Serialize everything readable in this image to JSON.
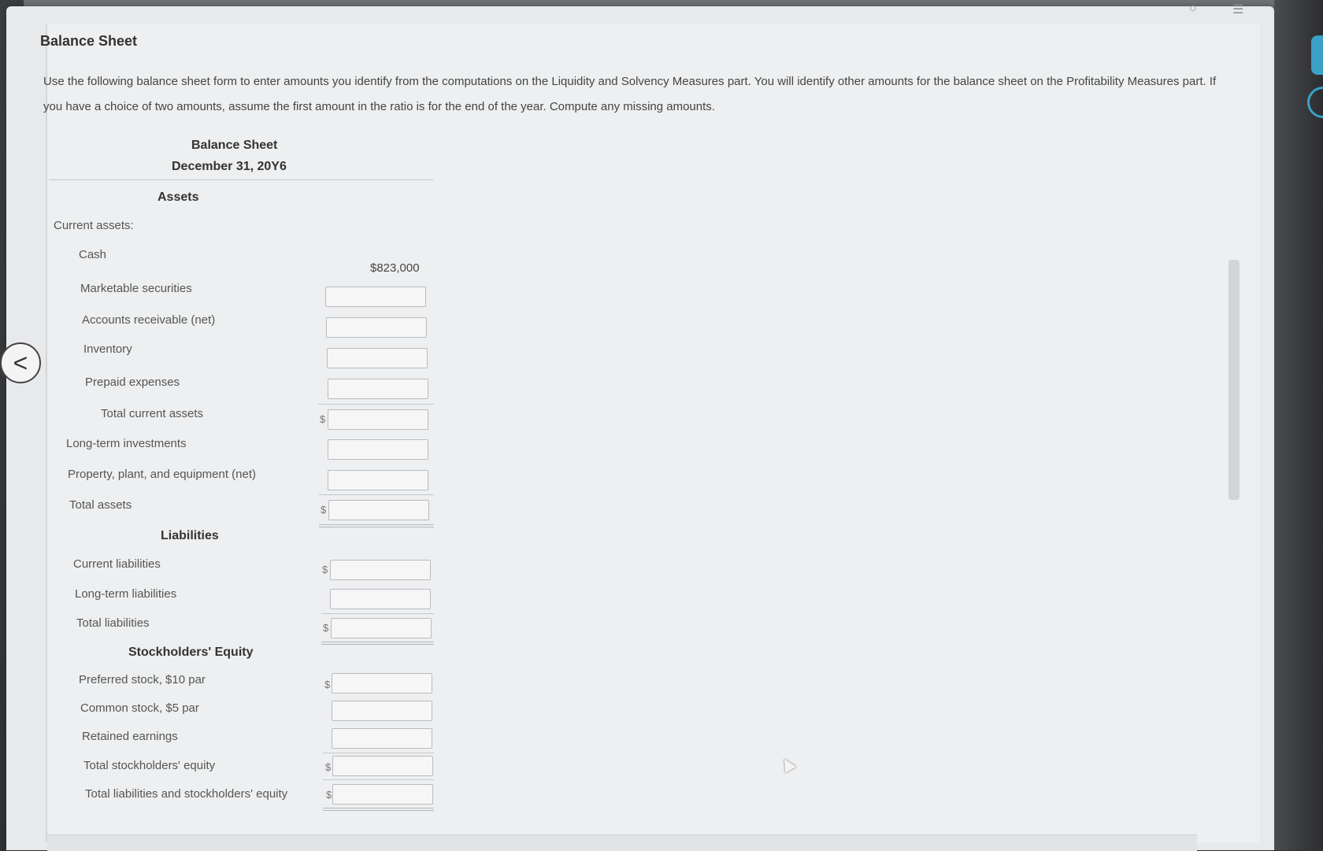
{
  "page": {
    "title": "Balance Sheet",
    "instructions": "Use the following balance sheet form to enter amounts you identify from the computations on the Liquidity and Solvency Measures part. You will identify other amounts for the balance sheet on the Profitability Measures part. If you have a choice of two amounts, assume the first amount in the ratio is for the end of the year. Compute any missing amounts."
  },
  "form": {
    "title": "Balance Sheet",
    "date": "December 31, 20Y6",
    "assets_header": "Assets",
    "current_assets_label": "Current assets:",
    "cash_label": "Cash",
    "cash_value": "$823,000",
    "marketable_securities_label": "Marketable securities",
    "accounts_receivable_label": "Accounts receivable (net)",
    "inventory_label": "Inventory",
    "prepaid_expenses_label": "Prepaid expenses",
    "total_current_assets_label": "Total current assets",
    "long_term_investments_label": "Long-term investments",
    "ppe_label": "Property, plant, and equipment (net)",
    "total_assets_label": "Total assets",
    "liabilities_header": "Liabilities",
    "current_liabilities_label": "Current liabilities",
    "long_term_liabilities_label": "Long-term liabilities",
    "total_liabilities_label": "Total liabilities",
    "equity_header": "Stockholders' Equity",
    "preferred_stock_label": "Preferred stock, $10 par",
    "common_stock_label": "Common stock, $5 par",
    "retained_earnings_label": "Retained earnings",
    "total_equity_label": "Total stockholders' equity",
    "total_liab_equity_label": "Total liabilities and stockholders' equity",
    "currency_symbol": "$"
  },
  "icons": {
    "back": "chevron-left-icon",
    "list": "list-icon",
    "settings": "plus-circle-icon"
  }
}
